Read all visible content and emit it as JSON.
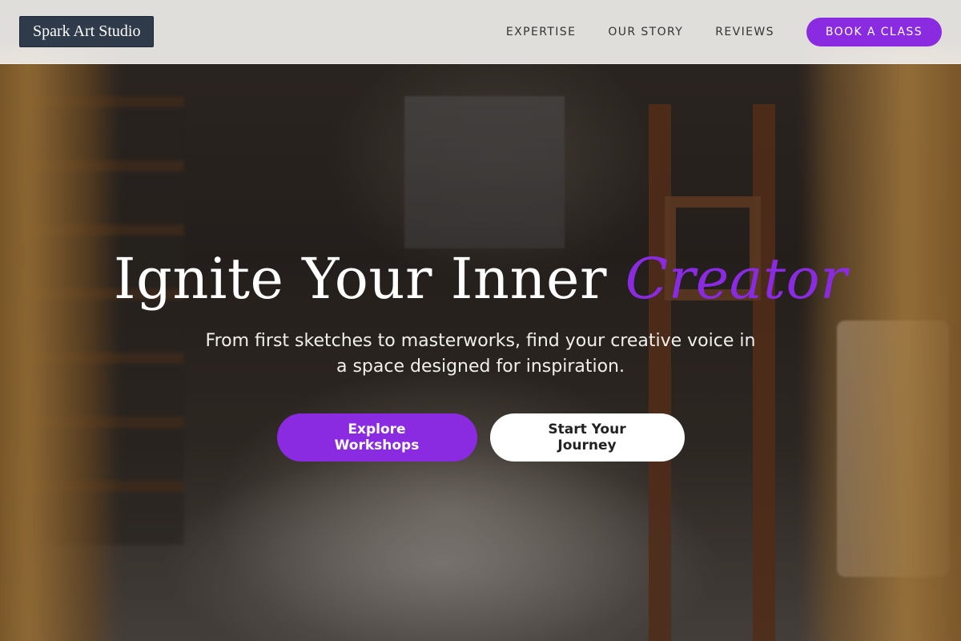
{
  "brand": {
    "name": "Spark Art Studio"
  },
  "nav": {
    "links": [
      "EXPERTISE",
      "OUR STORY",
      "REVIEWS"
    ],
    "cta_label": "BOOK A CLASS"
  },
  "hero": {
    "title_main": "Ignite Your Inner ",
    "title_accent": "Creator",
    "subtitle": "From first sketches to masterworks, find your creative voice in a space designed for inspiration.",
    "primary_button": "Explore Workshops",
    "secondary_button": "Start Your Journey"
  },
  "colors": {
    "accent": "#8a2be2",
    "brand_bg": "#2f3a4a"
  }
}
